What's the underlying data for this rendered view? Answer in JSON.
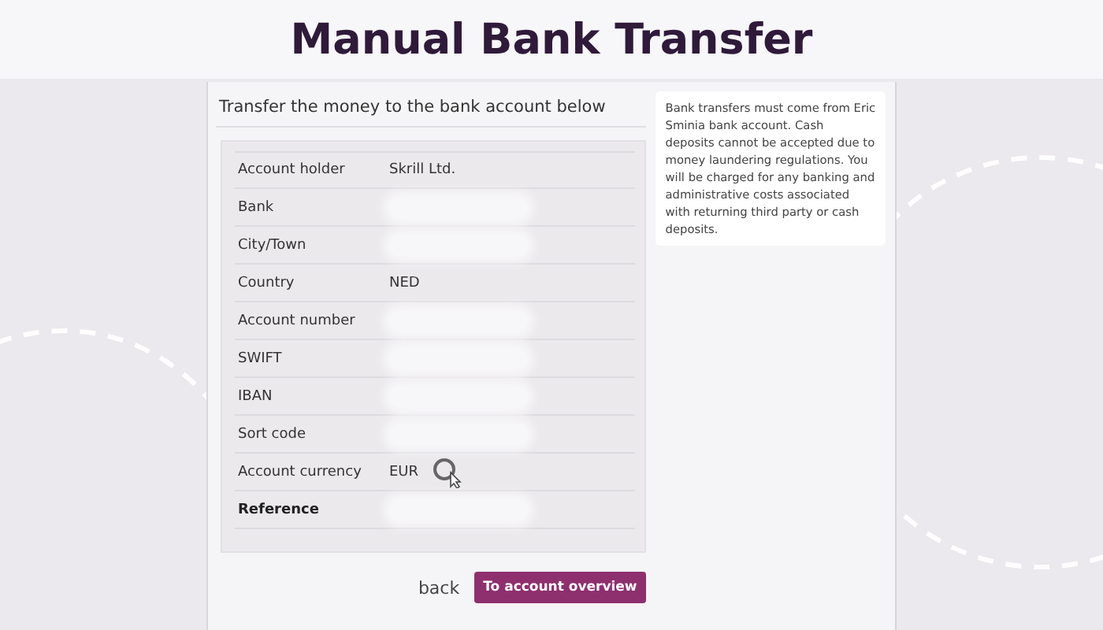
{
  "page_title": "Manual Bank Transfer",
  "transfer": {
    "heading": "Transfer the money to the bank account below",
    "rows": [
      {
        "label": "Account holder",
        "value": "Skrill Ltd.",
        "strong": false,
        "redacted": false
      },
      {
        "label": "Bank",
        "strong": false,
        "redacted": true
      },
      {
        "label": "City/Town",
        "strong": false,
        "redacted": true
      },
      {
        "label": "Country",
        "value": "NED",
        "strong": false,
        "redacted": false
      },
      {
        "label": "Account number",
        "strong": false,
        "redacted": true
      },
      {
        "label": "SWIFT",
        "strong": false,
        "redacted": true
      },
      {
        "label": "IBAN",
        "strong": false,
        "redacted": true
      },
      {
        "label": "Sort code",
        "strong": false,
        "redacted": true
      },
      {
        "label": "Account currency",
        "value": "EUR",
        "strong": false,
        "redacted": false
      },
      {
        "label": "Reference",
        "strong": true,
        "redacted": true
      }
    ]
  },
  "note": "Bank transfers must come from Eric Sminia bank account. Cash deposits cannot be accepted due to money laundering regulations. You will be charged for any banking and administrative costs associated with returning third party or cash deposits.",
  "actions": {
    "back": "back",
    "primary": "To account overview"
  }
}
